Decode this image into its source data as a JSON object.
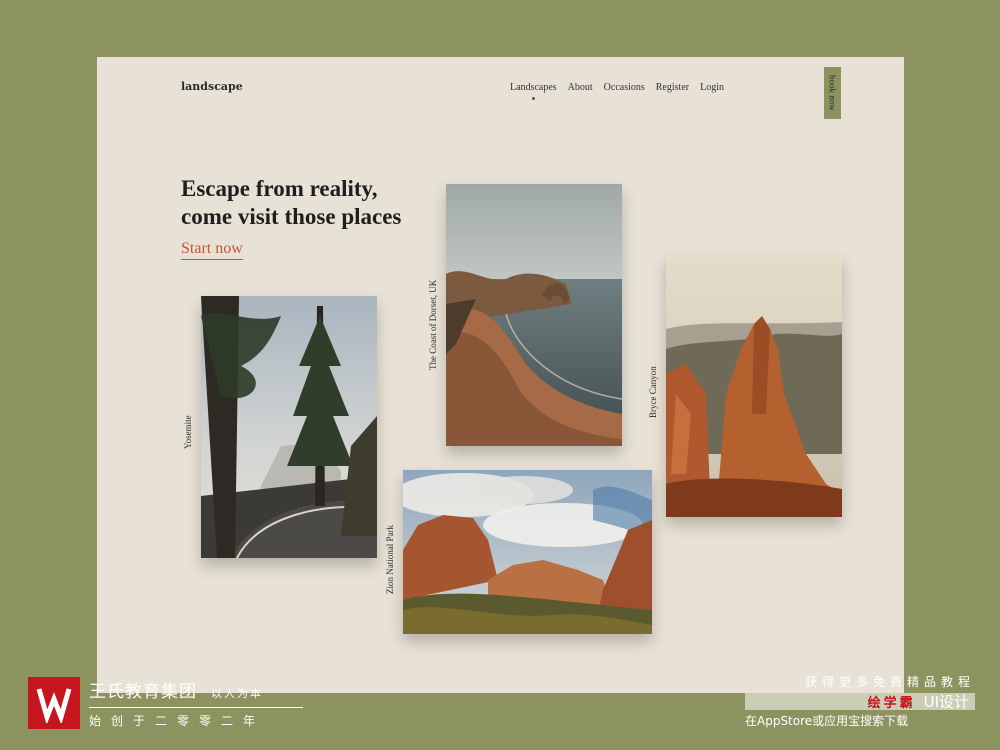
{
  "brand": {
    "logo": "landscape"
  },
  "nav": {
    "items": [
      {
        "label": "Landscapes"
      },
      {
        "label": "About"
      },
      {
        "label": "Occasions"
      },
      {
        "label": "Register"
      },
      {
        "label": "Login"
      }
    ],
    "book_label": "book now"
  },
  "hero": {
    "line1": "Escape from reality,",
    "line2": "come visit those places",
    "cta": "Start now"
  },
  "photos": {
    "yosemite": "Yosemite",
    "dorset": "The Coast of Dorset, UK",
    "bryce": "Bryce Canyon",
    "zion": "Zion National Park"
  },
  "watermark": {
    "company": "王氏教育集团",
    "slogan": "以人为本",
    "founded": "始创于二零零二年",
    "promo": "获得更多免费精品教程",
    "brand_red": "绘学霸",
    "brand_ui": "UI设计",
    "store": "在AppStore或应用宝搜索下载"
  },
  "colors": {
    "background": "#8d935f",
    "page": "#e8e2d6",
    "accent": "#c2553a",
    "book_button": "#8d935f",
    "watermark_red": "#c4161c"
  }
}
